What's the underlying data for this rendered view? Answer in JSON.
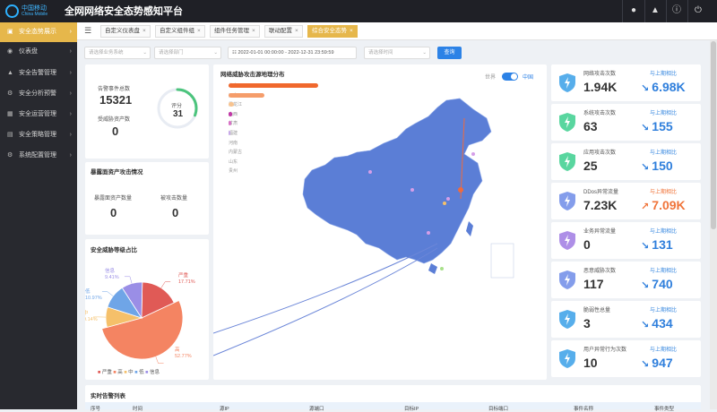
{
  "app": {
    "title": "全网网络安全态势感知平台",
    "logo_cn": "中国移动",
    "logo_en": "China Mobile"
  },
  "sidebar": {
    "items": [
      {
        "label": "安全态势展示",
        "active": true
      },
      {
        "label": "仪表盘"
      },
      {
        "label": "安全告警管理"
      },
      {
        "label": "安全分析预警"
      },
      {
        "label": "安全运营管理"
      },
      {
        "label": "安全策略管理"
      },
      {
        "label": "系统配置管理"
      }
    ]
  },
  "tabs": [
    {
      "label": "自定义仪表盘"
    },
    {
      "label": "自定义组件组"
    },
    {
      "label": "组件任务管理"
    },
    {
      "label": "联动配置"
    },
    {
      "label": "综合安全态势",
      "active": true
    }
  ],
  "filters": {
    "business_system": "请选择业务系统",
    "department": "请选择部门",
    "date_range": "2022-01-01 00:00:00 - 2022-12-31 23:59:59",
    "time_placeholder": "请选择时间",
    "query_label": "查询"
  },
  "overview": {
    "alarm_total_label": "告警事件总数",
    "alarm_total": "15321",
    "threat_assets_label": "受威胁资产数",
    "threat_assets": "0",
    "score_label": "评分",
    "score": "31",
    "score_fraction": 0.31
  },
  "exposure": {
    "title": "暴露面资产攻击情况",
    "exposed_label": "暴露面资产数量",
    "exposed_value": "0",
    "attacked_label": "被攻击数量",
    "attacked_value": "0"
  },
  "threat_level": {
    "title": "安全威胁等级占比",
    "slices": [
      {
        "name": "严重",
        "percent": 17.71,
        "label": "17.71%",
        "color": "#e05a56"
      },
      {
        "name": "高",
        "percent": 52.77,
        "label": "52.77%",
        "color": "#f48462"
      },
      {
        "name": "中",
        "percent": 9.14,
        "label": "9.14%",
        "color": "#f5c06a"
      },
      {
        "name": "低",
        "percent": 10.97,
        "label": "10.97%",
        "color": "#6fa5e7"
      },
      {
        "name": "信息",
        "percent": 9.41,
        "label": "9.41%",
        "color": "#9a8ee6"
      }
    ]
  },
  "map": {
    "title": "网络威胁攻击源地理分布",
    "toggle_left": "世界",
    "toggle_right": "中国",
    "bars": [
      {
        "name": "北京",
        "fraction": 1.0,
        "color": "#f0682d"
      },
      {
        "name": "辽宁",
        "fraction": 0.4,
        "color": "#f59d6b"
      },
      {
        "name": "黑龙江",
        "fraction": 0.06,
        "color": "#f7c38f"
      },
      {
        "name": "山西",
        "fraction": 0.04,
        "color": "#c03aa6"
      },
      {
        "name": "甘肃",
        "fraction": 0.03,
        "color": "#d873c6"
      },
      {
        "name": "福建",
        "fraction": 0.015,
        "color": "#c7a9e8"
      },
      {
        "name": "河南",
        "fraction": 0.0,
        "color": "#cccccc"
      },
      {
        "name": "内蒙古",
        "fraction": 0.0,
        "color": "#cccccc"
      },
      {
        "name": "山东",
        "fraction": 0.0,
        "color": "#cccccc"
      },
      {
        "name": "贵州",
        "fraction": 0.0,
        "color": "#cccccc"
      }
    ]
  },
  "stats": [
    {
      "label": "网络攻击次数",
      "value": "1.94K",
      "cmp_label": "与上期相比",
      "cmp_value": "6.98K",
      "trend": "down",
      "color": "#3aa0e8"
    },
    {
      "label": "系统攻击次数",
      "value": "63",
      "cmp_label": "与上期相比",
      "cmp_value": "155",
      "trend": "down",
      "color": "#3ccf8e"
    },
    {
      "label": "应用攻击次数",
      "value": "25",
      "cmp_label": "与上期相比",
      "cmp_value": "150",
      "trend": "down",
      "color": "#3ccf8e"
    },
    {
      "label": "DDos异常流量",
      "value": "7.23K",
      "cmp_label": "与上期相比",
      "cmp_value": "7.09K",
      "trend": "up",
      "color": "#6f8ce8"
    },
    {
      "label": "业务异常流量",
      "value": "0",
      "cmp_label": "与上期相比",
      "cmp_value": "131",
      "trend": "down",
      "color": "#a07be3"
    },
    {
      "label": "恶意威胁次数",
      "value": "117",
      "cmp_label": "与上期相比",
      "cmp_value": "740",
      "trend": "down",
      "color": "#6f8ce8"
    },
    {
      "label": "脆弱性总量",
      "value": "3",
      "cmp_label": "与上期相比",
      "cmp_value": "434",
      "trend": "down",
      "color": "#3aa0e8"
    },
    {
      "label": "用户异常行为次数",
      "value": "10",
      "cmp_label": "与上期相比",
      "cmp_value": "947",
      "trend": "down",
      "color": "#3aa0e8"
    }
  ],
  "alarm_list": {
    "title": "实时告警列表",
    "columns": [
      "序号",
      "时间",
      "源IP",
      "源端口",
      "目标IP",
      "目标端口",
      "事件名称",
      "事件类型"
    ]
  },
  "colors": {
    "accent": "#e6b74b",
    "primary": "#2c82e6",
    "map_fill": "#5b7ed6"
  }
}
